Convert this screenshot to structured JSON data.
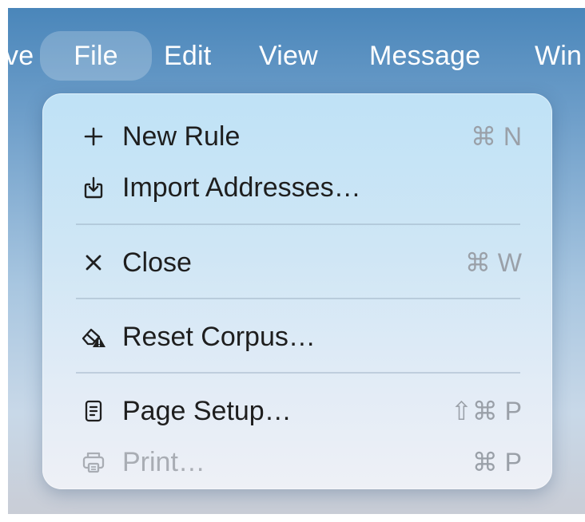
{
  "menubar": {
    "items": [
      {
        "label": "ve"
      },
      {
        "label": "File"
      },
      {
        "label": "Edit"
      },
      {
        "label": "View"
      },
      {
        "label": "Message"
      },
      {
        "label": "Win"
      }
    ]
  },
  "file_menu": {
    "items": [
      {
        "label": "New Rule",
        "shortcut": "⌘ N",
        "icon": "plus-icon"
      },
      {
        "label": "Import Addresses…",
        "shortcut": "",
        "icon": "import-icon"
      },
      {
        "label": "Close",
        "shortcut": "⌘ W",
        "icon": "close-icon"
      },
      {
        "label": "Reset Corpus…",
        "shortcut": "",
        "icon": "eraser-warning-icon"
      },
      {
        "label": "Page Setup…",
        "shortcut": "⇧⌘ P",
        "icon": "page-setup-icon"
      },
      {
        "label": "Print…",
        "shortcut": "⌘ P",
        "icon": "printer-icon",
        "disabled": true
      }
    ]
  }
}
